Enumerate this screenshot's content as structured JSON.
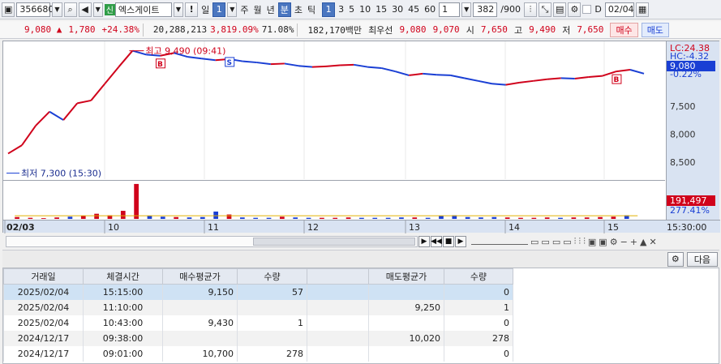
{
  "toolbar": {
    "stock_code": "356680",
    "exchange_badge": "신",
    "stock_name": "엑스게이트",
    "period_buttons": [
      "일",
      "1",
      "주",
      "월",
      "년",
      "분",
      "초",
      "틱"
    ],
    "interval_buttons": [
      "1",
      "3",
      "5",
      "10",
      "15",
      "30",
      "45",
      "60"
    ],
    "interval_value": "1",
    "count_value": "382",
    "count_max": "/900",
    "date_checkbox_label": "D",
    "date_value": "02/04"
  },
  "quote": {
    "price": "9,080",
    "change": "1,780",
    "change_pct": "+24.38%",
    "volume": "20,288,213",
    "volume_pct": "3,819.09%",
    "turnover_pct": "71.08%",
    "trade_value": "182,170백만",
    "best_label": "최우선",
    "best_ask": "9,080",
    "best_bid": "9,070",
    "open_label": "시",
    "open": "7,650",
    "high_label": "고",
    "high": "9,490",
    "low_label": "저",
    "low": "7,650",
    "buy_label": "매수",
    "sell_label": "매도"
  },
  "chart": {
    "high_annotation": "최고 9,490 (09:41)",
    "low_annotation": "최저 7,300 (15:30)",
    "y_labels": [
      {
        "text": "LC:24.38",
        "color": "#d0021b"
      },
      {
        "text": "HC:-4.32",
        "color": "#1a3fd4"
      },
      {
        "text": "9,080",
        "color": "#ffffff"
      },
      {
        "text": "-0.22%",
        "color": "#1a3fd4"
      },
      {
        "text": "8,500",
        "color": "#333333"
      },
      {
        "text": "8,000",
        "color": "#333333"
      },
      {
        "text": "7,500",
        "color": "#333333"
      }
    ],
    "volume_labels": [
      "191,497",
      "277.41%"
    ],
    "x_labels": [
      "02/03",
      "10",
      "11",
      "12",
      "13",
      "14",
      "15"
    ],
    "x_axis_end": "15:30:00",
    "signal_markers": [
      "B",
      "S",
      "B"
    ],
    "colors": {
      "up": "#d0021b",
      "down": "#1a3fd4",
      "price_tag_bg": "#1a3fd4",
      "vol_tag_bg": "#d0021b"
    }
  },
  "chart_data": {
    "type": "line",
    "title": "",
    "xlabel": "",
    "ylabel": "",
    "ylim": [
      7250,
      9600
    ],
    "x_ticks": [
      "02/03",
      "10",
      "11",
      "12",
      "13",
      "14",
      "15",
      "15:30:00"
    ],
    "y_ticks": [
      7500,
      8000,
      8500
    ],
    "grid": false,
    "series": [
      {
        "values": [
          7650,
          7800,
          8150,
          8400,
          8250,
          8550,
          8600,
          8900,
          9200,
          9490,
          9420,
          9400,
          9450,
          9380,
          9350,
          9320,
          9340,
          9300,
          9280,
          9250,
          9260,
          9220,
          9200,
          9210,
          9230,
          9240,
          9200,
          9180,
          9120,
          9050,
          9080,
          9060,
          9050,
          9000,
          8950,
          8900,
          8880,
          8920,
          8950,
          8980,
          9000,
          8990,
          9020,
          9040,
          9120,
          9150,
          9080
        ]
      }
    ],
    "annotations": [
      {
        "label": "최고 9,490 (09:41)",
        "y": 9490
      },
      {
        "label": "최저 7,300 (15:30)",
        "y": 7300
      }
    ],
    "volume": {
      "values": [
        5,
        3,
        2,
        4,
        6,
        9,
        14,
        10,
        22,
        95,
        8,
        6,
        5,
        4,
        5,
        20,
        12,
        4,
        3,
        3,
        6,
        4,
        3,
        3,
        3,
        4,
        3,
        3,
        3,
        4,
        4,
        3,
        8,
        10,
        5,
        4,
        5,
        4,
        3,
        3,
        4,
        3,
        4,
        4,
        5,
        6,
        10
      ]
    }
  },
  "table": {
    "headers": [
      "거래일",
      "체결시간",
      "매수평균가",
      "수량",
      "",
      "매도평균가",
      "수량"
    ],
    "rows": [
      [
        "2025/02/04",
        "15:15:00",
        "9,150",
        "57",
        "",
        "",
        "0"
      ],
      [
        "2025/02/04",
        "11:10:00",
        "",
        "",
        "",
        "9,250",
        "1"
      ],
      [
        "2025/02/04",
        "10:43:00",
        "9,430",
        "1",
        "",
        "",
        "0"
      ],
      [
        "2024/12/17",
        "09:38:00",
        "",
        "",
        "",
        "10,020",
        "278"
      ],
      [
        "2024/12/17",
        "09:01:00",
        "10,700",
        "278",
        "",
        "",
        "0"
      ]
    ],
    "next_label": "다음"
  }
}
